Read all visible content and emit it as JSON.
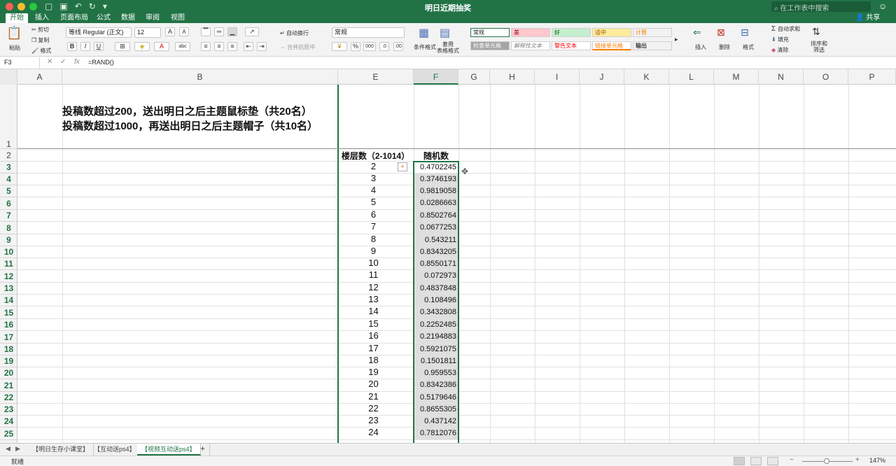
{
  "app": {
    "window_title": "明日近期抽奖",
    "search_placeholder": "在工作表中搜索",
    "share": "共享"
  },
  "ribbon": {
    "tabs": [
      "开始",
      "插入",
      "页面布局",
      "公式",
      "数据",
      "审阅",
      "视图"
    ],
    "paste": "粘贴",
    "cut": "剪切",
    "copy": "复制",
    "format_painter": "格式",
    "font_name": "等线 Regular (正文)",
    "font_size": "12",
    "bold": "B",
    "italic": "I",
    "underline": "U",
    "wrap_text": "自动换行",
    "merge_center": "合并后居中",
    "number_format": "常规",
    "percent": "%",
    "thousands": "000",
    "conditional_format": "条件格式",
    "table_format": "套用\n表格格式",
    "styles": [
      {
        "label": "常规",
        "bg": "#ffffff",
        "color": "#222222"
      },
      {
        "label": "差",
        "bg": "#ffc7ce",
        "color": "#9c0006"
      },
      {
        "label": "好",
        "bg": "#c6efce",
        "color": "#006100"
      },
      {
        "label": "适中",
        "bg": "#ffeb9c",
        "color": "#9c5700"
      },
      {
        "label": "计算",
        "bg": "#f2f2f2",
        "color": "#fa7d00"
      },
      {
        "label": "检查单元格",
        "bg": "#a5a5a5",
        "color": "#ffffff"
      },
      {
        "label": "解释性文本",
        "bg": "#ffffff",
        "color": "#7f7f7f"
      },
      {
        "label": "警告文本",
        "bg": "#ffffff",
        "color": "#ff0000"
      },
      {
        "label": "链接单元格",
        "bg": "#ffffff",
        "color": "#fa7d00"
      },
      {
        "label": "输出",
        "bg": "#f2f2f2",
        "color": "#3f3f3f"
      }
    ],
    "insert": "插入",
    "delete": "删除",
    "format": "格式",
    "autosum": "自动求和",
    "fill": "填充",
    "clear": "清除",
    "sort_filter": "排序和\n筛选"
  },
  "formula_bar": {
    "name_box": "F3",
    "cancel": "✕",
    "confirm": "✓",
    "fx": "fx",
    "formula": "=RAND()"
  },
  "columns": [
    "A",
    "B",
    "E",
    "F",
    "G",
    "H",
    "I",
    "J",
    "K",
    "L",
    "M",
    "N",
    "O",
    "P"
  ],
  "rows": [
    "1",
    "2",
    "3",
    "4",
    "5",
    "6",
    "7",
    "8",
    "9",
    "10",
    "11",
    "12",
    "13",
    "14",
    "15",
    "16",
    "17",
    "18",
    "19",
    "20",
    "21",
    "22",
    "23",
    "24",
    "25"
  ],
  "sheet": {
    "heading_line1": "投稿数超过200，送出明日之后主题鼠标垫（共20名）",
    "heading_line2": "投稿数超过1000，再送出明日之后主题帽子（共10名）",
    "floor_header": "楼层数（2-1014）",
    "random_header": "随机数",
    "floors": [
      "2",
      "3",
      "4",
      "5",
      "6",
      "7",
      "8",
      "9",
      "10",
      "11",
      "12",
      "13",
      "14",
      "15",
      "16",
      "17",
      "18",
      "19",
      "20",
      "21",
      "22",
      "23",
      "24"
    ],
    "randoms": [
      "0.4702245",
      "0.3746193",
      "0.9819058",
      "0.0286663",
      "0.8502764",
      "0.0677253",
      "0.543211",
      "0.8343205",
      "0.8550171",
      "0.072973",
      "0.4837848",
      "0.108496",
      "0.3432808",
      "0.2252485",
      "0.2194883",
      "0.5921075",
      "0.1501811",
      "0.959553",
      "0.8342386",
      "0.5179646",
      "0.8655305",
      "0.437142",
      "0.7812076"
    ]
  },
  "sheet_tabs": [
    "【明日生存小课堂】",
    "【互动送ps4】",
    "【视频互动送ps4】"
  ],
  "add_sheet": "+",
  "status": {
    "ready": "就绪",
    "zoom": "147%"
  }
}
